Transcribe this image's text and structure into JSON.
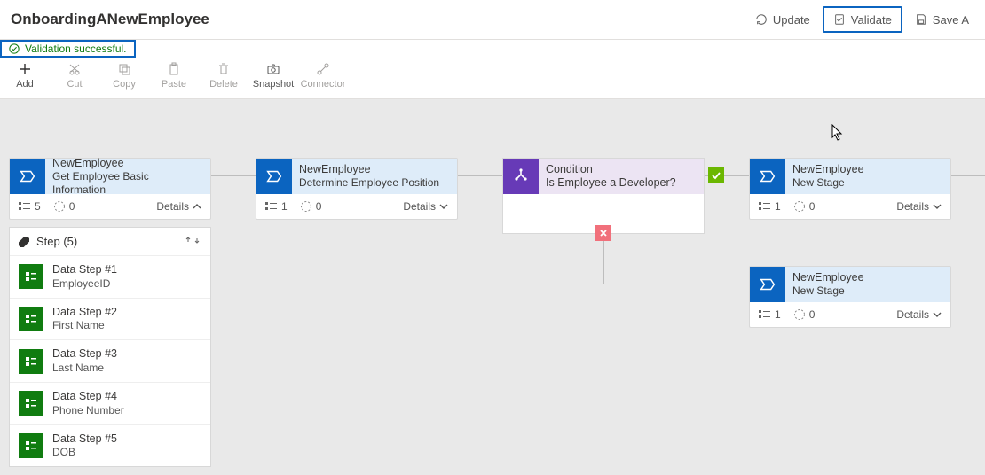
{
  "header": {
    "title": "OnboardingANewEmployee",
    "actions": {
      "update": "Update",
      "validate": "Validate",
      "save": "Save A"
    }
  },
  "status": {
    "message": "Validation successful."
  },
  "toolbar": {
    "add": "Add",
    "cut": "Cut",
    "copy": "Copy",
    "paste": "Paste",
    "delete": "Delete",
    "snapshot": "Snapshot",
    "connector": "Connector"
  },
  "stages": [
    {
      "entity": "NewEmployee",
      "title": "Get Employee Basic Information",
      "step_count": "5",
      "other_count": "0",
      "details": "Details",
      "expanded": true,
      "steps_label": "Step (5)",
      "steps": [
        {
          "name": "Data Step #1",
          "field": "EmployeeID"
        },
        {
          "name": "Data Step #2",
          "field": "First Name"
        },
        {
          "name": "Data Step #3",
          "field": "Last Name"
        },
        {
          "name": "Data Step #4",
          "field": "Phone Number"
        },
        {
          "name": "Data Step #5",
          "field": "DOB"
        }
      ]
    },
    {
      "entity": "NewEmployee",
      "title": "Determine Employee Position",
      "step_count": "1",
      "other_count": "0",
      "details": "Details",
      "expanded": false
    },
    {
      "entity": "NewEmployee",
      "title": "New Stage",
      "step_count": "1",
      "other_count": "0",
      "details": "Details",
      "expanded": false
    },
    {
      "entity": "NewEmployee",
      "title": "New Stage",
      "step_count": "1",
      "other_count": "0",
      "details": "Details",
      "expanded": false
    }
  ],
  "condition": {
    "label": "Condition",
    "question": "Is Employee a Developer?"
  }
}
